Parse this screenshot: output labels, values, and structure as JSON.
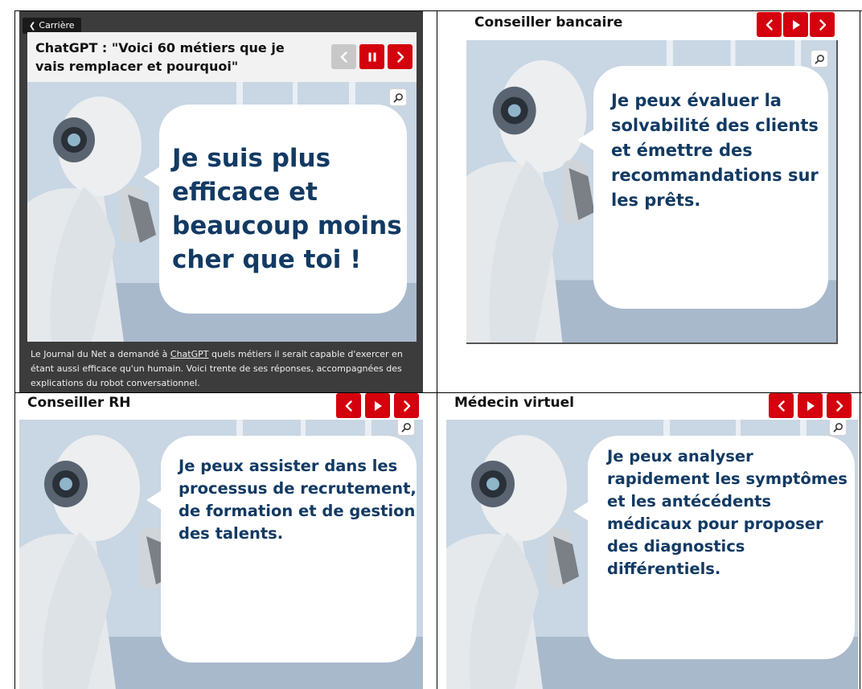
{
  "slide1": {
    "back_label": "Carrière",
    "title": "ChatGPT : \"Voici 60 métiers que je vais remplacer et pourquoi\"",
    "bubble": "Je suis plus efficace et beaucoup moins cher que toi !",
    "caption_before": "Le Journal du Net a demandé à ",
    "caption_link": "ChatGPT",
    "caption_after": " quels métiers il serait capable d'exercer en étant aussi efficace qu'un humain. Voici trente de ses réponses, accompagnées des explications du robot conversationnel."
  },
  "slide2": {
    "title": "Conseiller bancaire",
    "bubble": "Je peux évaluer la solvabilité des clients et émettre des recommandations sur les prêts."
  },
  "slide3": {
    "title": "Conseiller RH",
    "bubble": "Je peux assister dans les processus de recrutement, de formation et de gestion des talents."
  },
  "slide4": {
    "title": "Médecin virtuel",
    "bubble": "Je peux analyser rapidement les symptômes et les antécédents médicaux pour proposer des diagnostics différentiels."
  },
  "icons": {
    "prev": "chevron-left-icon",
    "next": "chevron-right-icon",
    "play": "play-icon",
    "pause": "pause-icon",
    "zoom": "magnifier-icon",
    "back": "chevron-left-small-icon"
  },
  "colors": {
    "accent": "#d4000d",
    "disabled": "#c8c8c8",
    "bubble_text": "#123a63",
    "dark_panel": "#3c3c3c"
  }
}
